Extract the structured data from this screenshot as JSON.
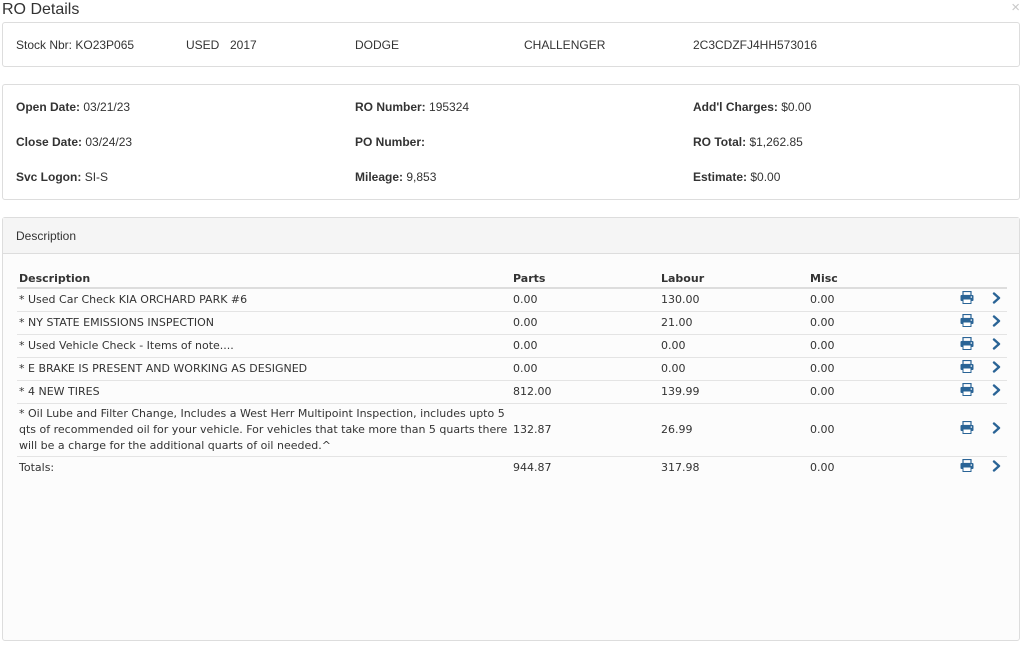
{
  "modal": {
    "title": "RO Details",
    "close_glyph": "×"
  },
  "vehicle": {
    "stock_nbr": "Stock Nbr: KO23P065",
    "condition": "USED",
    "year": "2017",
    "make": "DODGE",
    "model": "CHALLENGER",
    "vin": "2C3CDZFJ4HH573016"
  },
  "ro_info": {
    "open_date": {
      "label": "Open Date:",
      "value": "03/21/23"
    },
    "close_date": {
      "label": "Close Date:",
      "value": "03/24/23"
    },
    "svc_logon": {
      "label": "Svc Logon:",
      "value": "SI-S"
    },
    "ro_number": {
      "label": "RO Number:",
      "value": "195324"
    },
    "po_number": {
      "label": "PO Number:",
      "value": ""
    },
    "mileage": {
      "label": "Mileage:",
      "value": "9,853"
    },
    "addl_charges": {
      "label": "Add'l Charges:",
      "value": "$0.00"
    },
    "ro_total": {
      "label": "RO Total:",
      "value": "$1,262.85"
    },
    "estimate": {
      "label": "Estimate:",
      "value": "$0.00"
    }
  },
  "description_panel": {
    "title": "Description",
    "columns": {
      "description": "Description",
      "parts": "Parts",
      "labour": "Labour",
      "misc": "Misc"
    },
    "rows": [
      {
        "description": "* Used Car Check KIA ORCHARD PARK #6",
        "parts": "0.00",
        "labour": "130.00",
        "misc": "0.00"
      },
      {
        "description": "* NY STATE EMISSIONS INSPECTION",
        "parts": "0.00",
        "labour": "21.00",
        "misc": "0.00"
      },
      {
        "description": "* Used Vehicle Check - Items of note....",
        "parts": "0.00",
        "labour": "0.00",
        "misc": "0.00"
      },
      {
        "description": "* E BRAKE IS PRESENT AND WORKING AS DESIGNED",
        "parts": "0.00",
        "labour": "0.00",
        "misc": "0.00"
      },
      {
        "description": "* 4 NEW TIRES",
        "parts": "812.00",
        "labour": "139.99",
        "misc": "0.00"
      },
      {
        "description": "* Oil Lube and Filter Change, Includes a West Herr Multipoint Inspection, includes upto 5 qts of recommended oil for your vehicle. For vehicles that take more than 5 quarts there will be a charge for the additional quarts of oil needed.^",
        "parts": "132.87",
        "labour": "26.99",
        "misc": "0.00"
      }
    ],
    "totals": {
      "label": "Totals:",
      "parts": "944.87",
      "labour": "317.98",
      "misc": "0.00"
    }
  },
  "icons": {
    "print": "printer-icon",
    "go": "chevron-right-icon"
  },
  "colors": {
    "icon_blue": "#2a6496",
    "border": "#dddddd",
    "header_bg": "#f5f5f5"
  }
}
